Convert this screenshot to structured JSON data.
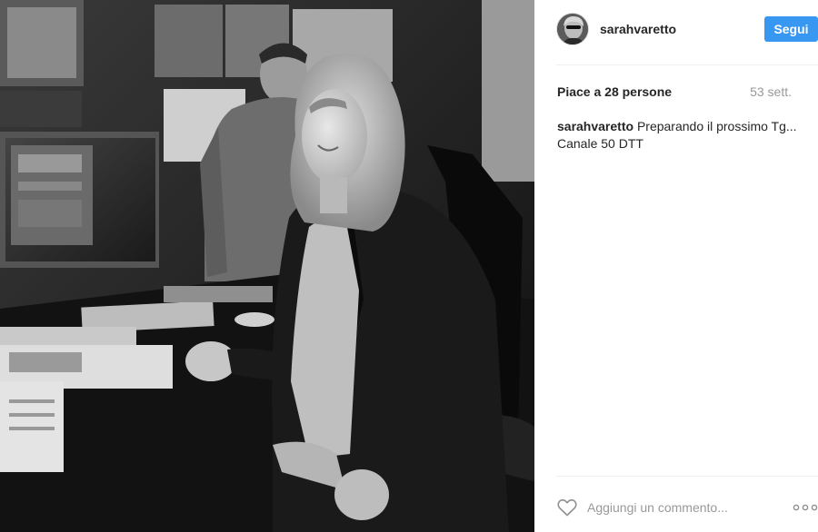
{
  "post": {
    "image_description": "",
    "user": {
      "username": "sarahvaretto"
    },
    "follow_label": "Segui",
    "likes_label": "Piace a 28 persone",
    "time_label": "53 sett.",
    "caption": {
      "username": "sarahvaretto",
      "text": "Preparando il prossimo Tg...",
      "text_line2": "Canale 50 DTT"
    },
    "comment_placeholder": "Aggiungi un commento...",
    "icons": {
      "like": "heart-icon",
      "options": "more-options-icon"
    },
    "colors": {
      "follow_button": "#3897f0",
      "muted_text": "#999999",
      "text": "#262626"
    }
  }
}
